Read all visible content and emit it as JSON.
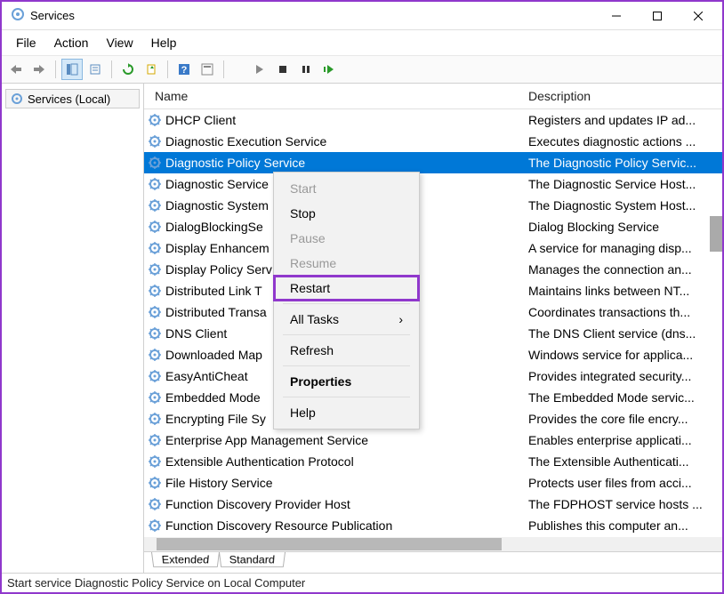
{
  "window": {
    "title": "Services"
  },
  "menubar": {
    "items": [
      "File",
      "Action",
      "View",
      "Help"
    ]
  },
  "tree": {
    "root_label": "Services (Local)"
  },
  "columns": {
    "name": "Name",
    "description": "Description"
  },
  "services": [
    {
      "name": "DHCP Client",
      "desc": "Registers and updates IP ad..."
    },
    {
      "name": "Diagnostic Execution Service",
      "desc": "Executes diagnostic actions ..."
    },
    {
      "name": "Diagnostic Policy Service",
      "desc": "The Diagnostic Policy Servic...",
      "selected": true
    },
    {
      "name": "Diagnostic Service",
      "desc": "The Diagnostic Service Host..."
    },
    {
      "name": "Diagnostic System",
      "desc": "The Diagnostic System Host..."
    },
    {
      "name": "DialogBlockingSe",
      "desc": "Dialog Blocking Service"
    },
    {
      "name": "Display Enhancem",
      "desc": "A service for managing disp..."
    },
    {
      "name": "Display Policy Serv",
      "desc": "Manages the connection an..."
    },
    {
      "name": "Distributed Link T",
      "desc": "Maintains links between NT..."
    },
    {
      "name": "Distributed Transa",
      "desc": "Coordinates transactions th..."
    },
    {
      "name": "DNS Client",
      "desc": "The DNS Client service (dns..."
    },
    {
      "name": "Downloaded Map",
      "desc": "Windows service for applica..."
    },
    {
      "name": "EasyAntiCheat",
      "desc": "Provides integrated security..."
    },
    {
      "name": "Embedded Mode",
      "desc": "The Embedded Mode servic..."
    },
    {
      "name": "Encrypting File Sy",
      "desc": "Provides the core file encry..."
    },
    {
      "name": "Enterprise App Management Service",
      "desc": "Enables enterprise applicati..."
    },
    {
      "name": "Extensible Authentication Protocol",
      "desc": "The Extensible Authenticati..."
    },
    {
      "name": "File History Service",
      "desc": "Protects user files from acci..."
    },
    {
      "name": "Function Discovery Provider Host",
      "desc": "The FDPHOST service hosts ..."
    },
    {
      "name": "Function Discovery Resource Publication",
      "desc": "Publishes this computer an..."
    }
  ],
  "context_menu": {
    "start": "Start",
    "stop": "Stop",
    "pause": "Pause",
    "resume": "Resume",
    "restart": "Restart",
    "all_tasks": "All Tasks",
    "refresh": "Refresh",
    "properties": "Properties",
    "help": "Help"
  },
  "bottom_tabs": {
    "extended": "Extended",
    "standard": "Standard"
  },
  "statusbar": {
    "text": "Start service Diagnostic Policy Service on Local Computer"
  }
}
